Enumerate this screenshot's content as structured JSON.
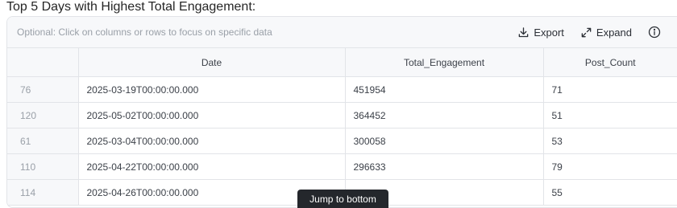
{
  "title": "Top 5 Days with Highest Total Engagement:",
  "toolbar": {
    "hint": "Optional: Click on columns or rows to focus on specific data",
    "export_label": "Export",
    "expand_label": "Expand",
    "export_icon": "download-icon",
    "expand_icon": "expand-arrows-icon",
    "info_icon": "info-icon"
  },
  "table": {
    "columns": [
      "",
      "Date",
      "Total_Engagement",
      "Post_Count"
    ],
    "rows": [
      {
        "index": "76",
        "date": "2025-03-19T00:00:00.000",
        "total_engagement": "451954",
        "post_count": "71"
      },
      {
        "index": "120",
        "date": "2025-05-02T00:00:00.000",
        "total_engagement": "364452",
        "post_count": "51"
      },
      {
        "index": "61",
        "date": "2025-03-04T00:00:00.000",
        "total_engagement": "300058",
        "post_count": "53"
      },
      {
        "index": "110",
        "date": "2025-04-22T00:00:00.000",
        "total_engagement": "296633",
        "post_count": "79"
      },
      {
        "index": "114",
        "date": "2025-04-26T00:00:00.000",
        "total_engagement": "",
        "post_count": "55"
      }
    ]
  },
  "jump_button": "Jump to bottom"
}
